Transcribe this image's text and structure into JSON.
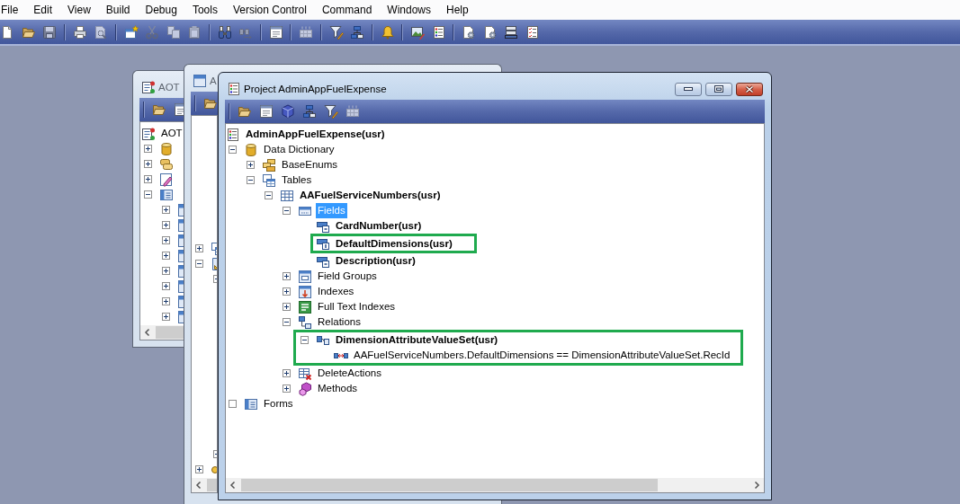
{
  "menu_bar": {
    "items": [
      "File",
      "Edit",
      "View",
      "Build",
      "Debug",
      "Tools",
      "Version Control",
      "Command",
      "Windows",
      "Help"
    ]
  },
  "toolbar": {
    "groups": [
      {
        "buttons": [
          {
            "kind": "new",
            "disabled": false
          },
          {
            "kind": "open",
            "disabled": false
          },
          {
            "kind": "save",
            "disabled": true
          }
        ]
      },
      {
        "buttons": [
          {
            "kind": "print",
            "disabled": false
          },
          {
            "kind": "preview",
            "disabled": true
          }
        ]
      },
      {
        "buttons": [
          {
            "kind": "newwindow",
            "disabled": false
          },
          {
            "kind": "cut",
            "disabled": true
          },
          {
            "kind": "copy",
            "disabled": true
          },
          {
            "kind": "paste",
            "disabled": true
          }
        ]
      },
      {
        "buttons": [
          {
            "kind": "find",
            "disabled": false
          },
          {
            "kind": "findnext",
            "disabled": true
          }
        ]
      },
      {
        "buttons": [
          {
            "kind": "form",
            "disabled": false
          }
        ]
      },
      {
        "buttons": [
          {
            "kind": "grid",
            "disabled": true
          }
        ]
      },
      {
        "buttons": [
          {
            "kind": "filter",
            "disabled": false
          },
          {
            "kind": "sort",
            "disabled": false
          }
        ]
      },
      {
        "buttons": [
          {
            "kind": "bell",
            "disabled": false
          }
        ]
      },
      {
        "buttons": [
          {
            "kind": "imageedit",
            "disabled": false
          },
          {
            "kind": "list",
            "disabled": false
          }
        ]
      },
      {
        "buttons": [
          {
            "kind": "gear",
            "disabled": false
          },
          {
            "kind": "gear",
            "disabled": false
          },
          {
            "kind": "server",
            "disabled": false
          },
          {
            "kind": "checklist",
            "disabled": false
          }
        ]
      }
    ]
  },
  "windows": [
    {
      "title": "AOT",
      "active": false,
      "toolbar": [
        {
          "kind": "open",
          "disabled": false
        },
        {
          "kind": "form",
          "disabled": false
        }
      ],
      "tree": [
        {
          "label": "AOT",
          "kind": "aot",
          "bold": false,
          "selected": false,
          "children": [
            {
              "kind": "dictionary",
              "expanded": false
            },
            {
              "kind": "scrolls",
              "expanded": false
            },
            {
              "kind": "sketch",
              "expanded": false
            },
            {
              "kind": "forms",
              "expanded": true,
              "children": [
                {
                  "kind": "window",
                  "expanded": false
                },
                {
                  "kind": "window",
                  "expanded": false
                },
                {
                  "kind": "window",
                  "expanded": false
                },
                {
                  "kind": "window",
                  "expanded": false
                },
                {
                  "kind": "window",
                  "expanded": false
                },
                {
                  "kind": "window",
                  "expanded": false
                },
                {
                  "kind": "window",
                  "expanded": false
                },
                {
                  "kind": "window",
                  "expanded": false
                }
              ]
            }
          ]
        }
      ]
    },
    {
      "title": "A",
      "active": false,
      "toolbar": [
        {
          "kind": "open",
          "disabled": false
        }
      ],
      "tree": [
        {
          "kind": "tables",
          "expanded": false
        },
        {
          "kind": "document",
          "expanded": true,
          "children": [
            {
              "expanded": true
            },
            {
              "expanded": true
            }
          ]
        },
        {
          "kind": "key",
          "expanded": false
        }
      ]
    },
    {
      "title": "Project AdminAppFuelExpense",
      "active": true,
      "toolbar": [
        {
          "kind": "open",
          "disabled": false
        },
        {
          "kind": "form",
          "disabled": false
        },
        {
          "kind": "cube",
          "disabled": false
        },
        {
          "kind": "sort",
          "disabled": false
        },
        {
          "kind": "filter",
          "disabled": false
        },
        {
          "kind": "grid",
          "disabled": true
        }
      ],
      "tree": [
        {
          "label": "AdminAppFuelExpense(usr)",
          "kind": "list",
          "bold": true,
          "selected": false,
          "outlined": false,
          "children": [
            {
              "label": "Data Dictionary",
              "kind": "dictionary",
              "expanded": true,
              "empty": false,
              "bold": false,
              "selected": false,
              "outlined": false,
              "children": [
                {
                  "label": "BaseEnums",
                  "kind": "enums",
                  "expanded": false,
                  "empty": false,
                  "bold": false,
                  "selected": false,
                  "outlined": false
                },
                {
                  "label": "Tables",
                  "kind": "tables",
                  "expanded": true,
                  "empty": false,
                  "bold": false,
                  "selected": false,
                  "outlined": false,
                  "children": [
                    {
                      "label": "AAFuelServiceNumbers(usr)",
                      "kind": "table",
                      "expanded": true,
                      "empty": false,
                      "bold": true,
                      "selected": false,
                      "outlined": false,
                      "children": [
                        {
                          "label": "Fields",
                          "kind": "fields",
                          "expanded": true,
                          "empty": false,
                          "bold": false,
                          "selected": true,
                          "outlined": false,
                          "children": [
                            {
                              "label": "CardNumber(usr)",
                              "kind": "textfield",
                              "bold": true,
                              "selected": false,
                              "outlined": false
                            },
                            {
                              "label": "DefaultDimensions(usr)",
                              "kind": "numberfield",
                              "bold": true,
                              "selected": false,
                              "outlined": true
                            },
                            {
                              "label": "Description(usr)",
                              "kind": "textfield",
                              "bold": true,
                              "selected": false,
                              "outlined": false
                            }
                          ]
                        },
                        {
                          "label": "Field Groups",
                          "kind": "fieldgroups",
                          "expanded": false,
                          "empty": false,
                          "bold": false,
                          "selected": false,
                          "outlined": false
                        },
                        {
                          "label": "Indexes",
                          "kind": "indexes",
                          "expanded": false,
                          "empty": false,
                          "bold": false,
                          "selected": false,
                          "outlined": false
                        },
                        {
                          "label": "Full Text Indexes",
                          "kind": "fulltext",
                          "expanded": false,
                          "empty": false,
                          "bold": false,
                          "selected": false,
                          "outlined": false
                        },
                        {
                          "label": "Relations",
                          "kind": "relations",
                          "expanded": true,
                          "empty": false,
                          "bold": false,
                          "selected": false,
                          "outlined": false,
                          "children": [
                            {
                              "label": "DimensionAttributeValueSet(usr)",
                              "kind": "relation",
                              "expanded": true,
                              "empty": false,
                              "bold": true,
                              "selected": false,
                              "outlined": true,
                              "children": [
                                {
                                  "label": "AAFuelServiceNumbers.DefaultDimensions == DimensionAttributeValueSet.RecId",
                                  "kind": "link",
                                  "bold": false,
                                  "selected": false,
                                  "outlined": false
                                }
                              ]
                            }
                          ]
                        },
                        {
                          "label": "DeleteActions",
                          "kind": "deleteactions",
                          "expanded": false,
                          "empty": false,
                          "bold": false,
                          "selected": false,
                          "outlined": false
                        },
                        {
                          "label": "Methods",
                          "kind": "methods",
                          "expanded": false,
                          "empty": false,
                          "bold": false,
                          "selected": false,
                          "outlined": false
                        }
                      ]
                    }
                  ]
                }
              ]
            },
            {
              "label": "Forms",
              "kind": "forms",
              "empty": true,
              "bold": false,
              "selected": false,
              "outlined": false
            }
          ]
        }
      ]
    }
  ]
}
